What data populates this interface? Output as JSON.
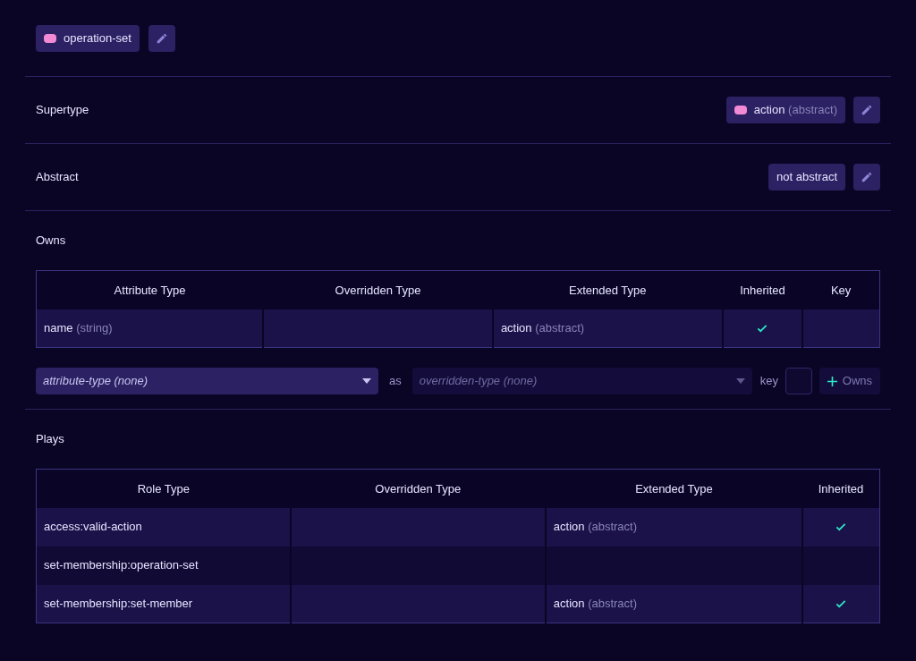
{
  "header": {
    "type_label": "operation-set",
    "color": "#f38ad6"
  },
  "supertype": {
    "label": "Supertype",
    "value": "action",
    "qualifier": "(abstract)",
    "color": "#f38ad6"
  },
  "abstract": {
    "label": "Abstract",
    "value": "not abstract"
  },
  "owns": {
    "title": "Owns",
    "columns": [
      "Attribute Type",
      "Overridden Type",
      "Extended Type",
      "Inherited",
      "Key"
    ],
    "rows": [
      {
        "attribute": {
          "name": "name",
          "qualifier": "(string)"
        },
        "overridden": null,
        "extended": {
          "name": "action",
          "qualifier": "(abstract)"
        },
        "inherited": true,
        "key": false
      }
    ],
    "form": {
      "attribute_select": {
        "value": "attribute-type (none)",
        "disabled": false
      },
      "as_label": "as",
      "overridden_select": {
        "value": "overridden-type (none)",
        "disabled": true
      },
      "key_label": "key",
      "key_checked": false,
      "add_button": "Owns"
    }
  },
  "plays": {
    "title": "Plays",
    "columns": [
      "Role Type",
      "Overridden Type",
      "Extended Type",
      "Inherited"
    ],
    "rows": [
      {
        "role": "access:valid-action",
        "overridden": null,
        "extended": {
          "name": "action",
          "qualifier": "(abstract)"
        },
        "inherited": true
      },
      {
        "role": "set-membership:operation-set",
        "overridden": null,
        "extended": null,
        "inherited": false
      },
      {
        "role": "set-membership:set-member",
        "overridden": null,
        "extended": {
          "name": "action",
          "qualifier": "(abstract)"
        },
        "inherited": true
      }
    ]
  }
}
